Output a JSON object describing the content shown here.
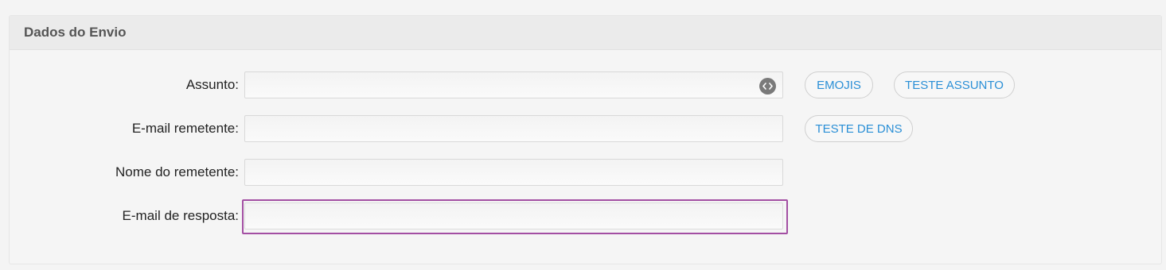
{
  "section": {
    "title": "Dados do Envio"
  },
  "fields": {
    "assunto": {
      "label": "Assunto:",
      "value": ""
    },
    "email_remetente": {
      "label": "E-mail remetente:",
      "value": ""
    },
    "nome_remetente": {
      "label": "Nome do remetente:",
      "value": ""
    },
    "email_resposta": {
      "label": "E-mail de resposta:",
      "value": ""
    }
  },
  "buttons": {
    "emojis": "EMOJIS",
    "teste_assunto": "TESTE ASSUNTO",
    "teste_dns": "TESTE DE DNS"
  },
  "icons": {
    "assunto_variable": "code-icon"
  },
  "colors": {
    "link_blue": "#2a8fd6",
    "focus_purple": "#a34fa3"
  }
}
